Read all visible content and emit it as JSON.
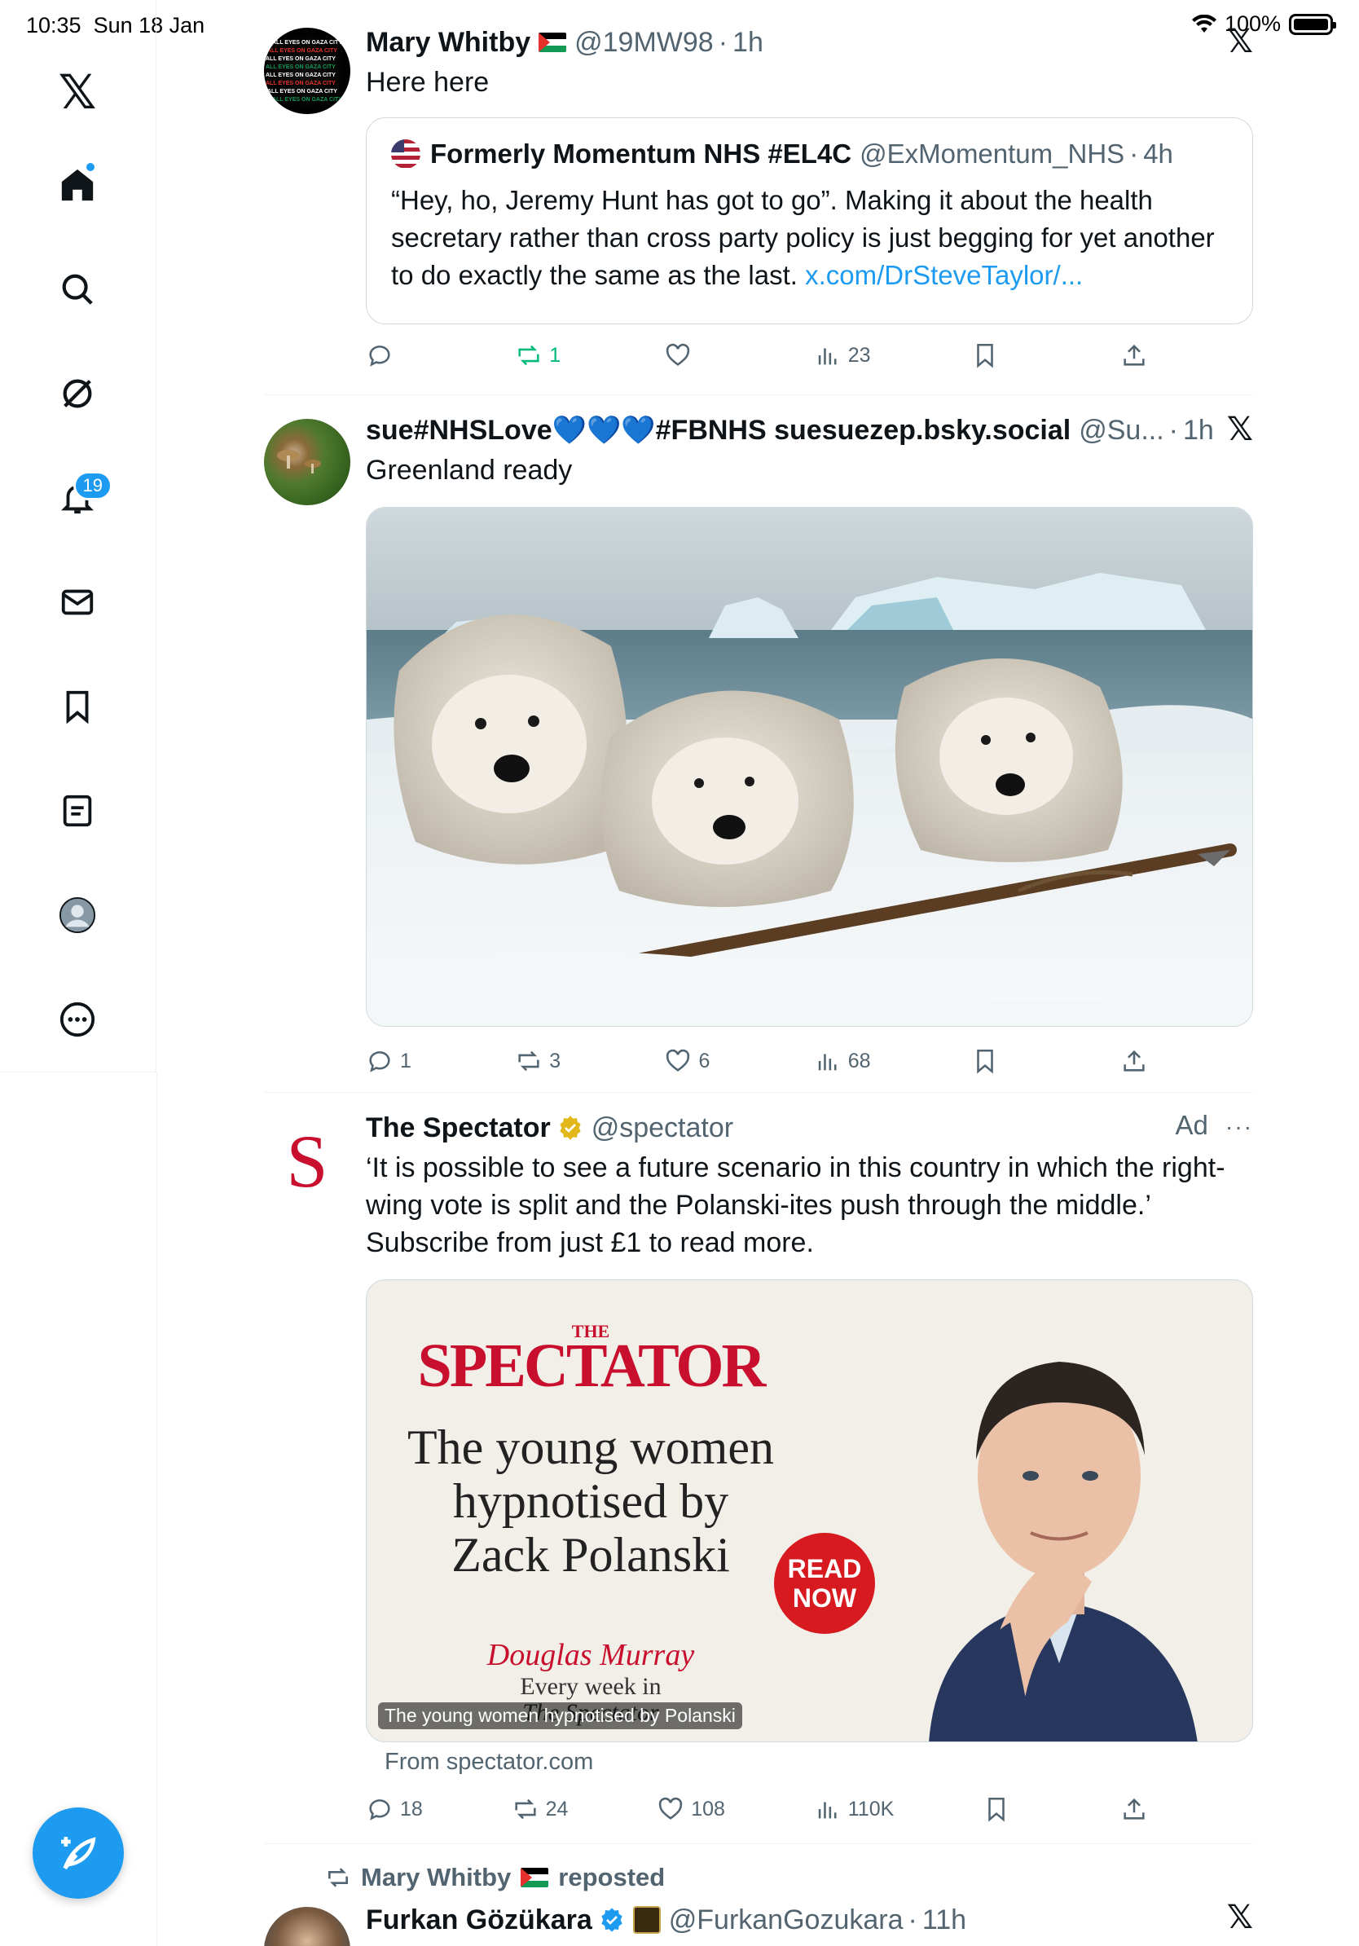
{
  "status_bar": {
    "time": "10:35",
    "date": "Sun 18 Jan",
    "battery": "100%"
  },
  "sidebar": {
    "notification_count": "19"
  },
  "posts": [
    {
      "name": "Mary Whitby",
      "handle": "@19MW98",
      "time": "1h",
      "text": "Here here",
      "quote": {
        "name": "Formerly Momentum NHS #EL4C",
        "handle": "@ExMomentum_NHS",
        "time": "4h",
        "text": "“Hey, ho, Jeremy Hunt has got to go”. Making it about the health secretary rather than cross party policy is just begging for yet another to do exactly the same as the last.",
        "link": "x.com/DrSteveTaylor/..."
      },
      "actions": {
        "replies": "",
        "reposts": "1",
        "likes": "",
        "views": "23"
      }
    },
    {
      "name": "sue#NHSLove💙💙💙#FBNHS suesuezep.bsky.social",
      "handle": "@Su...",
      "time": "1h",
      "text": "Greenland ready",
      "actions": {
        "replies": "1",
        "reposts": "3",
        "likes": "6",
        "views": "68"
      }
    },
    {
      "name": "The Spectator",
      "handle": "@spectator",
      "ad": "Ad",
      "text": "‘It is possible to see a future scenario in this country in which the right-wing vote is split and the Polanski-ites push through the middle.’ Subscribe from just £1 to read more.",
      "card": {
        "masthead_small": "THE",
        "masthead": "SPECTATOR",
        "headline_1": "The young women",
        "headline_2": "hypnotised by",
        "headline_3": "Zack Polanski",
        "badge_1": "READ",
        "badge_2": "NOW",
        "author": "Douglas Murray",
        "tagline": "Every week in",
        "tagline_2": "The Spectator",
        "caption": "The young women hypnotised by Polanski",
        "source": "From spectator.com"
      },
      "actions": {
        "replies": "18",
        "reposts": "24",
        "likes": "108",
        "views": "110K"
      }
    },
    {
      "repost_by": "Mary Whitby",
      "repost_word": "reposted",
      "name": "Furkan Gözükara",
      "handle": "@FurkanGozukara",
      "time": "11h"
    }
  ],
  "colors": {
    "accent": "#1d9bf0",
    "repost_green": "#00ba7c",
    "spectator_red": "#c8102e"
  }
}
